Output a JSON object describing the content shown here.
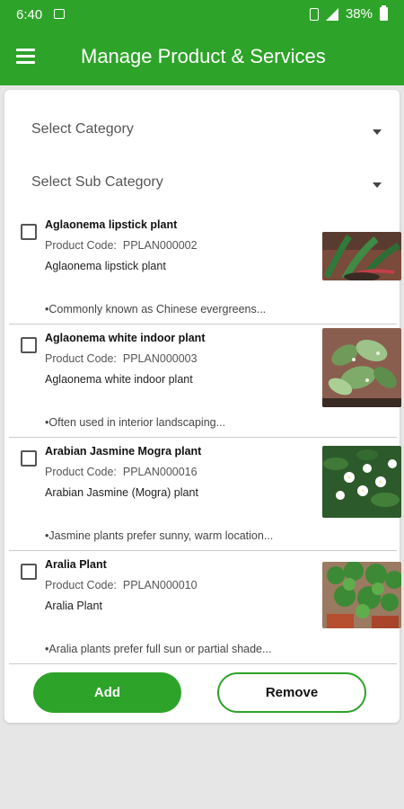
{
  "status_bar": {
    "time": "6:40",
    "battery": "38%"
  },
  "app_bar": {
    "title": "Manage Product & Services"
  },
  "filters": {
    "category_placeholder": "Select Category",
    "subcategory_placeholder": "Select Sub Category"
  },
  "products": [
    {
      "name": "Aglaonema lipstick plant",
      "code_label": "Product Code:",
      "code": "PPLAN000002",
      "description": "Aglaonema lipstick plant",
      "note": "•Commonly known as Chinese evergreens..."
    },
    {
      "name": "Aglaonema white indoor plant",
      "code_label": "Product Code:",
      "code": "PPLAN000003",
      "description": "Aglaonema white indoor plant",
      "note": "•Often used in interior landscaping..."
    },
    {
      "name": "Arabian Jasmine Mogra plant",
      "code_label": "Product Code:",
      "code": "PPLAN000016",
      "description": "Arabian Jasmine (Mogra) plant",
      "note": "•Jasmine plants prefer sunny, warm location..."
    },
    {
      "name": "Aralia Plant",
      "code_label": "Product Code:",
      "code": "PPLAN000010",
      "description": "Aralia Plant",
      "note": "•Aralia plants prefer full sun or partial shade..."
    }
  ],
  "actions": {
    "add_label": "Add",
    "remove_label": "Remove"
  },
  "colors": {
    "primary": "#2ea32a",
    "background": "#e6e6e6",
    "card": "#ffffff"
  }
}
